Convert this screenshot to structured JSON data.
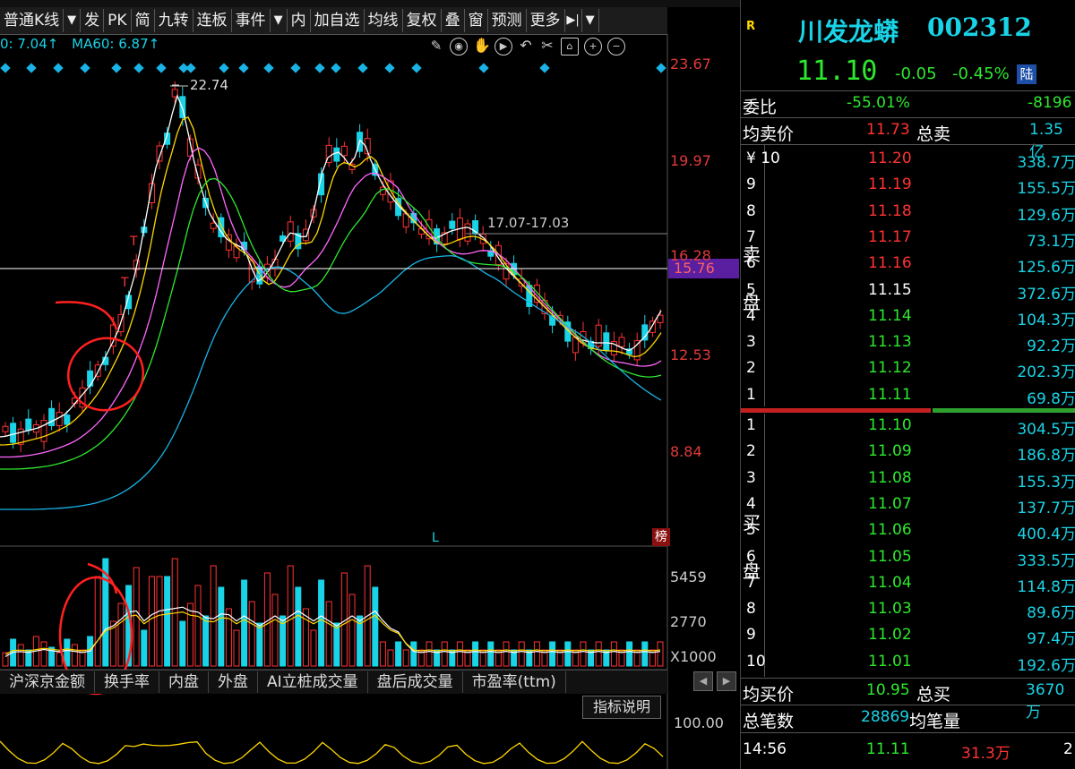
{
  "toolbar": {
    "items": [
      "普通K线",
      "▼",
      "发",
      "PK",
      "简",
      "九转",
      "连板",
      "事件",
      "▼",
      "内",
      "加自选",
      "均线",
      "复权",
      "叠",
      "窗",
      "预测",
      "更多",
      "▶|",
      "▼"
    ]
  },
  "ma_line": {
    "prefix": "0: 7.04↑",
    "ma60_label": "MA60: 6.87↑"
  },
  "chart_labels": {
    "high": "22.74",
    "range": "17.07-17.03",
    "marker_T": "T",
    "marker_L": "L",
    "rank": "榜"
  },
  "price_axis": [
    "23.67",
    "19.97",
    "16.28",
    "15.76",
    "12.53",
    "8.84"
  ],
  "volume_axis": [
    "5459",
    "2770",
    "X1000"
  ],
  "indicator_axis": [
    "100.00"
  ],
  "indicator_tabs": [
    "沪深京金额",
    "换手率",
    "内盘",
    "外盘",
    "AI立桩成交量",
    "盘后成交量",
    "市盈率(ttm)"
  ],
  "indicator_explain": "指标说明",
  "colors": {
    "up": "#ff3333",
    "down": "#19d3e6",
    "ma5": "#ffffff",
    "ma10": "#ffd700",
    "ma20": "#ff66ff",
    "ma30": "#2ee82e",
    "ma60": "#19b3e6",
    "annot": "#ff2020"
  },
  "stock": {
    "badge": "R",
    "name": "川发龙蟒",
    "code": "002312",
    "price": "11.10",
    "change": "-0.05",
    "change_pct": "-0.45%",
    "exchange": "陆"
  },
  "ratio": {
    "label": "委比",
    "value": "-55.01%",
    "diff": "-8196"
  },
  "avg_sell": {
    "label": "均卖价",
    "value": "11.73",
    "total_label": "总卖",
    "total": "1.35亿"
  },
  "sell_side_label": [
    "卖",
    "盘"
  ],
  "buy_side_label": [
    "买",
    "盘"
  ],
  "sell_orders": [
    {
      "lvl": "¥ 10",
      "price": "11.20",
      "vol": "338.7万",
      "color": "rd"
    },
    {
      "lvl": "9",
      "price": "11.19",
      "vol": "155.5万",
      "color": "rd"
    },
    {
      "lvl": "8",
      "price": "11.18",
      "vol": "129.6万",
      "color": "rd"
    },
    {
      "lvl": "7",
      "price": "11.17",
      "vol": "73.1万",
      "color": "rd"
    },
    {
      "lvl": "6",
      "price": "11.16",
      "vol": "125.6万",
      "color": "rd"
    },
    {
      "lvl": "5",
      "price": "11.15",
      "vol": "372.6万",
      "color": "wt"
    },
    {
      "lvl": "4",
      "price": "11.14",
      "vol": "104.3万",
      "color": "gr"
    },
    {
      "lvl": "3",
      "price": "11.13",
      "vol": "92.2万",
      "color": "gr"
    },
    {
      "lvl": "2",
      "price": "11.12",
      "vol": "202.3万",
      "color": "gr"
    },
    {
      "lvl": "1",
      "price": "11.11",
      "vol": "69.8万",
      "color": "gr"
    }
  ],
  "buy_orders": [
    {
      "lvl": "1",
      "price": "11.10",
      "vol": "304.5万"
    },
    {
      "lvl": "2",
      "price": "11.09",
      "vol": "186.8万"
    },
    {
      "lvl": "3",
      "price": "11.08",
      "vol": "155.3万"
    },
    {
      "lvl": "4",
      "price": "11.07",
      "vol": "137.7万"
    },
    {
      "lvl": "5",
      "price": "11.06",
      "vol": "400.4万"
    },
    {
      "lvl": "6",
      "price": "11.05",
      "vol": "333.5万"
    },
    {
      "lvl": "7",
      "price": "11.04",
      "vol": "114.8万"
    },
    {
      "lvl": "8",
      "price": "11.03",
      "vol": "89.6万"
    },
    {
      "lvl": "9",
      "price": "11.02",
      "vol": "97.4万"
    },
    {
      "lvl": "10",
      "price": "11.01",
      "vol": "192.6万"
    }
  ],
  "avg_buy": {
    "label": "均买价",
    "value": "10.95",
    "total_label": "总买",
    "total": "3670万"
  },
  "deals": {
    "label": "总笔数",
    "value": "28869",
    "avg_label": "均笔量"
  },
  "last_trade": {
    "time": "14:56",
    "price": "11.11",
    "vol": "31.3万",
    "extra": "2"
  }
}
